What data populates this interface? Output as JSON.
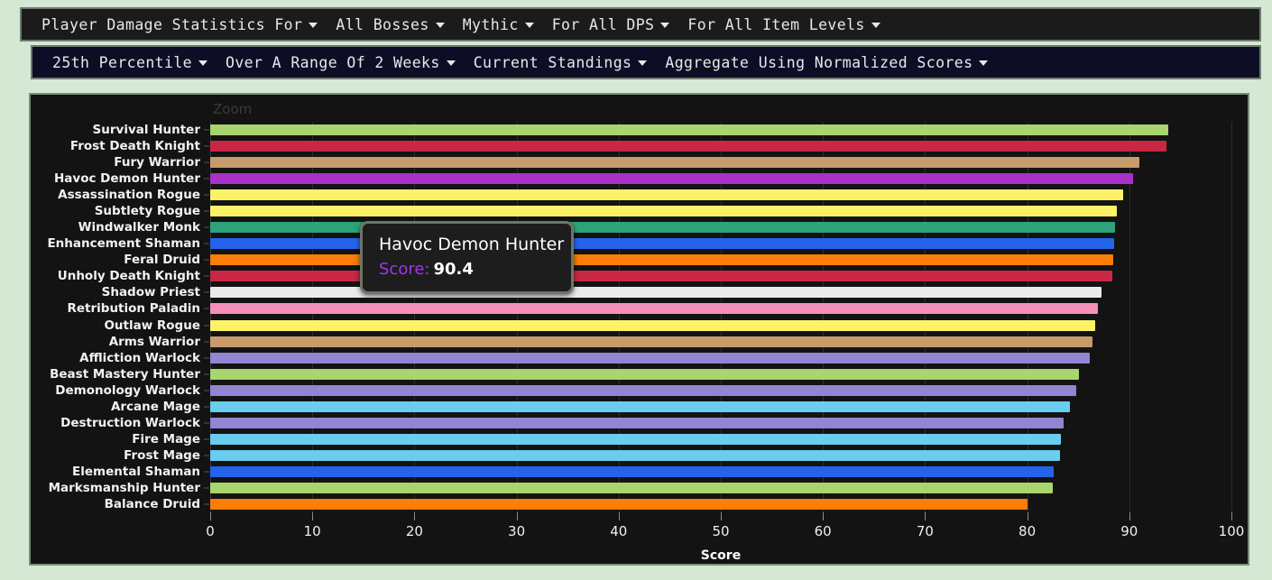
{
  "theme": {
    "page_background": "#d4e8d4",
    "panel_background": "#131313",
    "primary_menu_background": "#1b1b1b",
    "secondary_menu_background": "#0d0d26",
    "border": "#7d8a7d",
    "tooltip_accent": "#a335ee"
  },
  "menus": {
    "primary": [
      {
        "label": "Player Damage Statistics For",
        "caret": "chevron-down-icon"
      },
      {
        "label": "All Bosses",
        "caret": "chevron-down-icon"
      },
      {
        "label": "Mythic",
        "caret": "chevron-down-icon"
      },
      {
        "label": "For All DPS",
        "caret": "chevron-down-icon"
      },
      {
        "label": "For All Item Levels",
        "caret": "chevron-down-icon"
      }
    ],
    "secondary": [
      {
        "label": "25th Percentile",
        "caret": "chevron-down-icon"
      },
      {
        "label": "Over A Range Of 2 Weeks",
        "caret": "chevron-down-icon"
      },
      {
        "label": "Current Standings",
        "caret": "chevron-down-icon"
      },
      {
        "label": "Aggregate Using Normalized Scores",
        "caret": "chevron-down-icon"
      }
    ]
  },
  "chart_panel": {
    "zoom_label": "Zoom"
  },
  "tooltip": {
    "title": "Havoc Demon Hunter",
    "metric_label": "Score:",
    "metric_value": "90.4"
  },
  "chart_data": {
    "type": "bar",
    "orientation": "horizontal",
    "title": "",
    "xlabel": "Score",
    "ylabel": "",
    "xlim": [
      0,
      100
    ],
    "xticks": [
      0,
      10,
      20,
      30,
      40,
      50,
      60,
      70,
      80,
      90,
      100
    ],
    "grid": true,
    "legend": "none",
    "categories": [
      "Survival Hunter",
      "Frost Death Knight",
      "Fury Warrior",
      "Havoc Demon Hunter",
      "Assassination Rogue",
      "Subtlety Rogue",
      "Windwalker Monk",
      "Enhancement Shaman",
      "Feral Druid",
      "Unholy Death Knight",
      "Shadow Priest",
      "Retribution Paladin",
      "Outlaw Rogue",
      "Arms Warrior",
      "Affliction Warlock",
      "Beast Mastery Hunter",
      "Demonology Warlock",
      "Arcane Mage",
      "Destruction Warlock",
      "Fire Mage",
      "Frost Mage",
      "Elemental Shaman",
      "Marksmanship Hunter",
      "Balance Druid"
    ],
    "values": [
      93.8,
      93.6,
      91.0,
      90.4,
      89.4,
      88.8,
      88.6,
      88.5,
      88.4,
      88.3,
      87.3,
      86.9,
      86.7,
      86.4,
      86.1,
      85.1,
      84.8,
      84.2,
      83.6,
      83.3,
      83.2,
      82.6,
      82.5,
      80.0
    ],
    "colors": [
      "#aad372",
      "#c41e3a",
      "#c69b6d",
      "#a330c9",
      "#fff468",
      "#fff468",
      "#00ff98",
      "#0070dd",
      "#ff7c0a",
      "#c41e3a",
      "#ffffff",
      "#f48cba",
      "#fff468",
      "#c69b6d",
      "#8788ee",
      "#aad372",
      "#8788ee",
      "#3fc7eb",
      "#8788ee",
      "#3fc7eb",
      "#3fc7eb",
      "#0070dd",
      "#aad372",
      "#ff7c0a"
    ],
    "rendered_colors": [
      "#a9d46e",
      "#ca2744",
      "#c89b6c",
      "#a832c8",
      "#fcf268",
      "#fcf268",
      "#2ea27a",
      "#2563eb",
      "#fc7d07",
      "#ca2744",
      "#ebebeb",
      "#f68fb8",
      "#fcf268",
      "#c89b6c",
      "#9185d4",
      "#a9d46e",
      "#9185d4",
      "#68cdef",
      "#9185d4",
      "#68cdef",
      "#68cdef",
      "#2563eb",
      "#a9d46e",
      "#fc7d07"
    ]
  }
}
